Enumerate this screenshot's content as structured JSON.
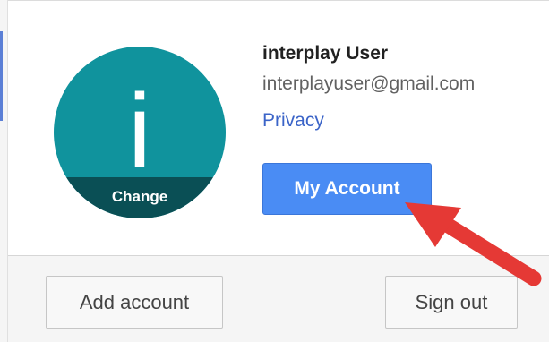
{
  "avatar": {
    "letter": "i",
    "change_label": "Change",
    "background_color": "#10939d",
    "overlay_color": "#0a4f55"
  },
  "user": {
    "name": "interplay User",
    "email": "interplayuser@gmail.com"
  },
  "links": {
    "privacy": "Privacy"
  },
  "buttons": {
    "my_account": "My Account",
    "add_account": "Add account",
    "sign_out": "Sign out"
  },
  "annotation": {
    "icon": "red-arrow-icon",
    "color": "#e53935"
  }
}
